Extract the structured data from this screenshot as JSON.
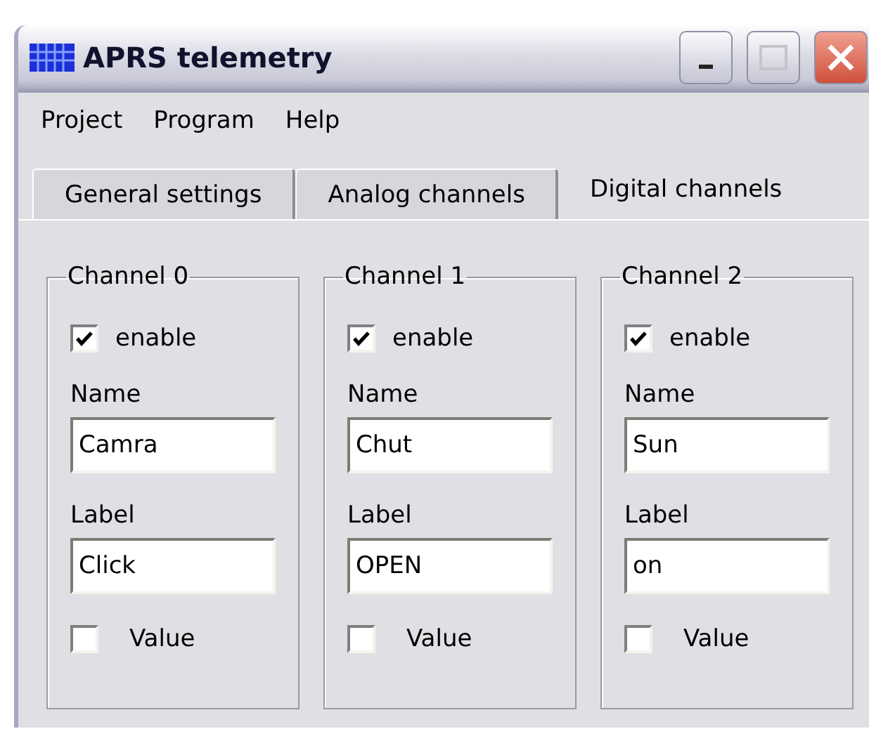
{
  "window": {
    "title": "APRS telemetry"
  },
  "menu": [
    "Project",
    "Program",
    "Help"
  ],
  "tabs": [
    {
      "label": "General settings",
      "selected": false
    },
    {
      "label": "Analog channels",
      "selected": false
    },
    {
      "label": "Digital channels",
      "selected": true
    }
  ],
  "channels": [
    {
      "title": "Channel 0",
      "enable_label": "enable",
      "enabled": true,
      "name_label": "Name",
      "name": "Camra",
      "label_label": "Label",
      "label": "Click",
      "value_label": "Value",
      "value": false
    },
    {
      "title": "Channel 1",
      "enable_label": "enable",
      "enabled": true,
      "name_label": "Name",
      "name": "Chut",
      "label_label": "Label",
      "label": "OPEN",
      "value_label": "Value",
      "value": false
    },
    {
      "title": "Channel 2",
      "enable_label": "enable",
      "enabled": true,
      "name_label": "Name",
      "name": "Sun",
      "label_label": "Label",
      "label": "on",
      "value_label": "Value",
      "value": false
    }
  ]
}
